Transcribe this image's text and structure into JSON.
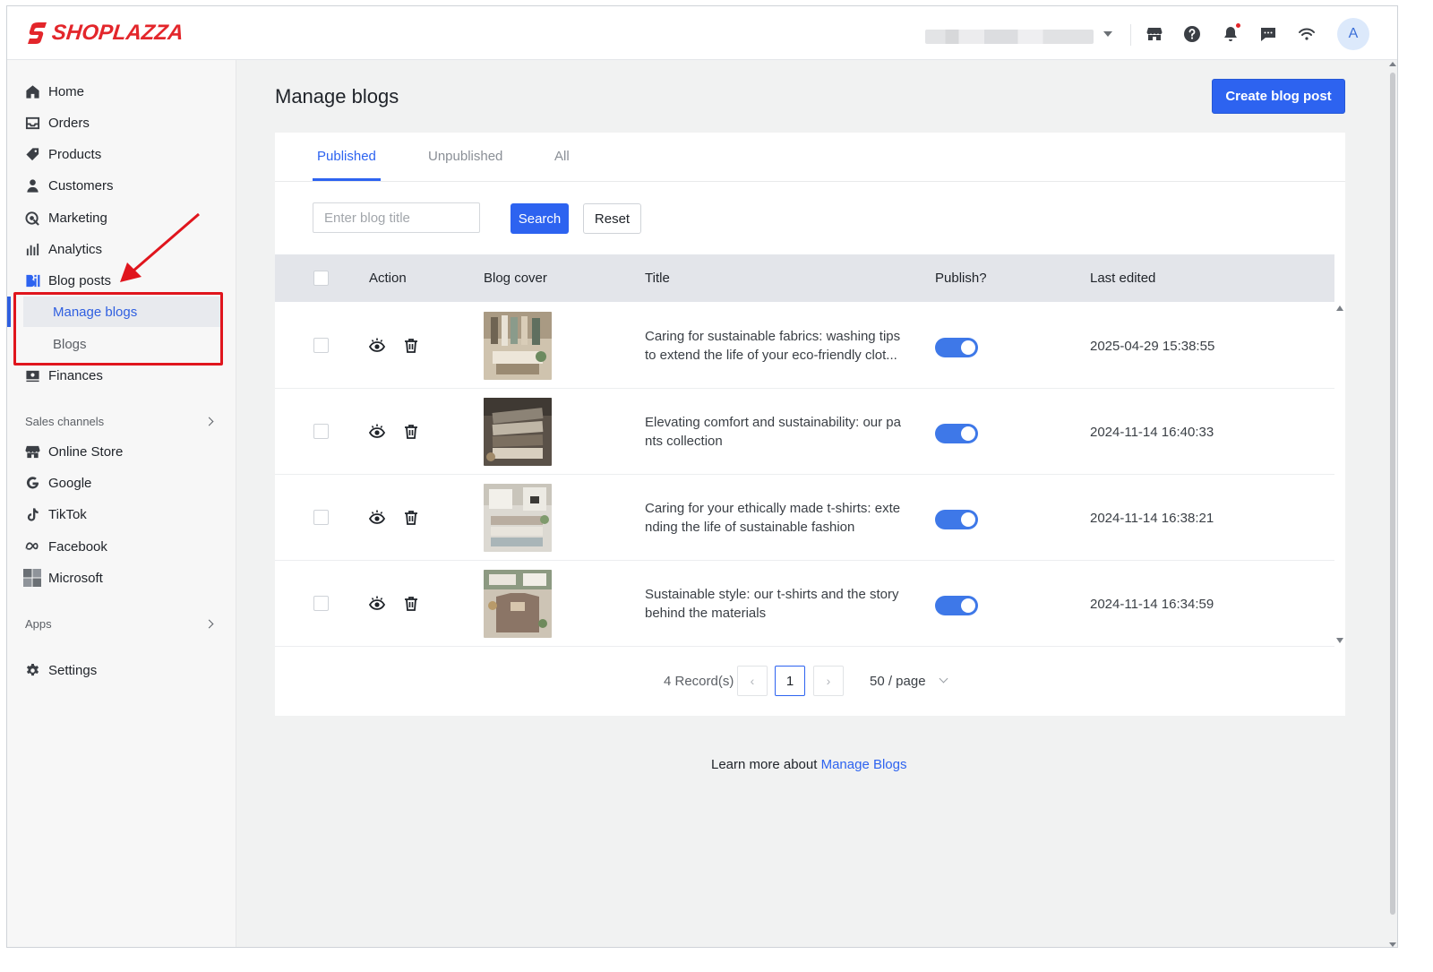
{
  "brand": {
    "name": "SHOPLAZZA",
    "color": "#e3262b"
  },
  "accent_color": "#2d63f0",
  "topbar": {
    "icons": [
      "store-icon",
      "help-icon",
      "bell-icon",
      "message-icon",
      "wifi-icon"
    ],
    "avatar_initial": "A"
  },
  "sidebar": {
    "items": [
      {
        "label": "Home",
        "icon": "home-icon"
      },
      {
        "label": "Orders",
        "icon": "inbox-icon"
      },
      {
        "label": "Products",
        "icon": "tag-icon"
      },
      {
        "label": "Customers",
        "icon": "person-icon"
      },
      {
        "label": "Marketing",
        "icon": "marketing-icon"
      },
      {
        "label": "Analytics",
        "icon": "bar-chart-icon"
      },
      {
        "label": "Blog posts",
        "icon": "blog-icon"
      },
      {
        "label": "Finances",
        "icon": "finance-icon"
      }
    ],
    "blog_subitems": [
      {
        "label": "Manage blogs",
        "active": true
      },
      {
        "label": "Blogs",
        "active": false
      }
    ],
    "sales_channels_label": "Sales channels",
    "channels": [
      {
        "label": "Online Store",
        "icon": "store-icon"
      },
      {
        "label": "Google",
        "icon": "google-icon"
      },
      {
        "label": "TikTok",
        "icon": "tiktok-icon"
      },
      {
        "label": "Facebook",
        "icon": "meta-icon"
      },
      {
        "label": "Microsoft",
        "icon": "microsoft-icon"
      }
    ],
    "apps_label": "Apps",
    "settings_label": "Settings"
  },
  "main": {
    "title": "Manage blogs",
    "create_button": "Create blog post",
    "tabs": [
      {
        "label": "Published",
        "active": true
      },
      {
        "label": "Unpublished",
        "active": false
      },
      {
        "label": "All",
        "active": false
      }
    ],
    "search": {
      "placeholder": "Enter blog title",
      "value": "",
      "search_label": "Search",
      "reset_label": "Reset"
    },
    "table": {
      "columns": [
        "Action",
        "Blog cover",
        "Title",
        "Publish?",
        "Last edited"
      ],
      "rows": [
        {
          "title_line1": "Caring for sustainable fabrics: washing tips",
          "title_line2": "to extend the life of your eco-friendly clot...",
          "published": true,
          "last_edited": "2025-04-29 15:38:55"
        },
        {
          "title_line1": "Elevating comfort and sustainability: our pa",
          "title_line2": "nts collection",
          "published": true,
          "last_edited": "2024-11-14 16:40:33"
        },
        {
          "title_line1": "Caring for your ethically made t-shirts: exte",
          "title_line2": "nding the life of sustainable fashion",
          "published": true,
          "last_edited": "2024-11-14 16:38:21"
        },
        {
          "title_line1": "Sustainable style: our t-shirts and the story",
          "title_line2": "behind the materials",
          "published": true,
          "last_edited": "2024-11-14 16:34:59"
        }
      ]
    },
    "pagination": {
      "records": "4 Record(s)",
      "current_page": "1",
      "page_size": "50 / page"
    },
    "learn_more": {
      "prefix": "Learn more about",
      "link": "Manage Blogs"
    }
  }
}
